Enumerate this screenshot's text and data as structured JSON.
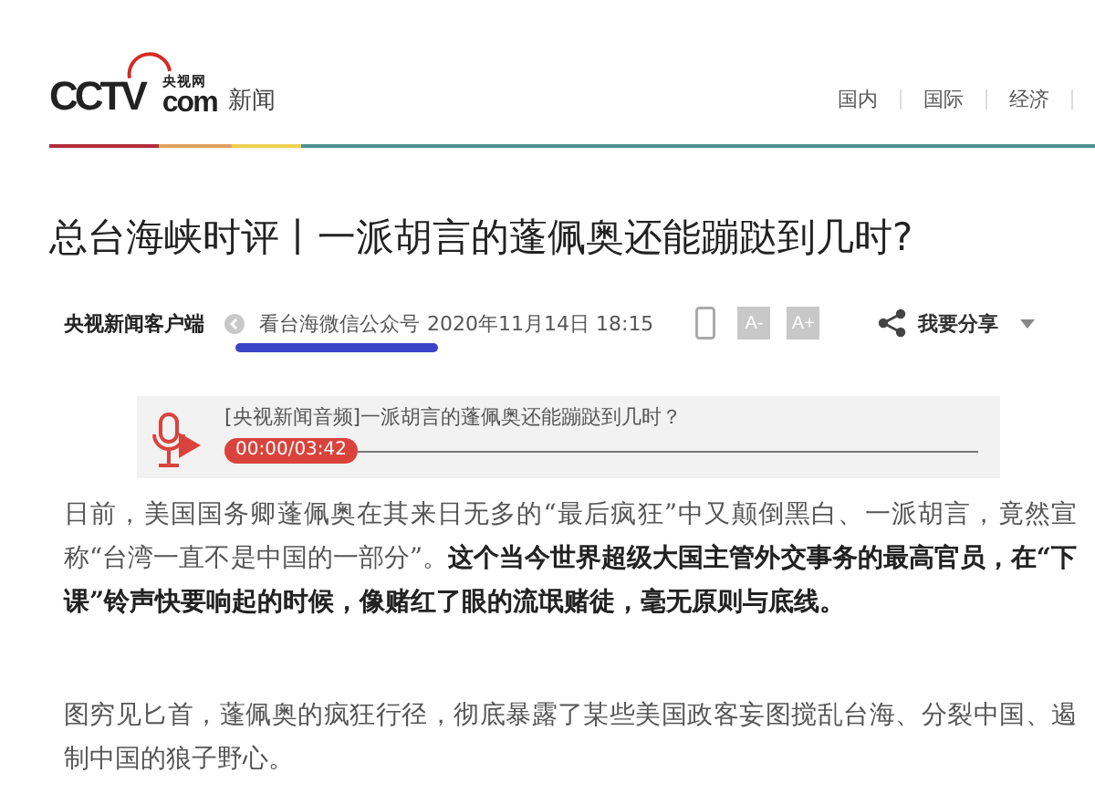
{
  "logo": {
    "mark": "CCTV",
    "sub": "央视网",
    "domain": "com",
    "section": "新闻"
  },
  "nav": [
    {
      "label": "国内"
    },
    {
      "label": "国际"
    },
    {
      "label": "经济"
    }
  ],
  "article": {
    "title": "总台海峡时评丨一派胡言的蓬佩奥还能蹦跶到几时?",
    "source": "央视新闻客户端",
    "origin": "看台海微信公众号",
    "datetime": "2020年11月14日 18:15",
    "font_buttons": [
      "A-",
      "A+"
    ],
    "share": "我要分享",
    "audio": {
      "title": "[央视新闻音频]一派胡言的蓬佩奥还能蹦跶到几时？",
      "time": "00:00/03:42"
    },
    "paragraphs": [
      "日前，美国国务卿蓬佩奥在其来日无多的“最后疯狂”中又颠倒黑白、一派胡言，竟然宣称“台湾一直不是中国的一部分”。**这个当今世界超级大国主管外交事务的最高官员，在“下课”铃声快要响起的时候，像赌红了眼的流氓赌徒，毫无原则与底线。**",
      "图穷见匕首，蓬佩奥的疯狂行径，彻底暴露了某些美国政客妄图搅乱台海、分裂中国、遏制中国的狼子野心。"
    ]
  }
}
